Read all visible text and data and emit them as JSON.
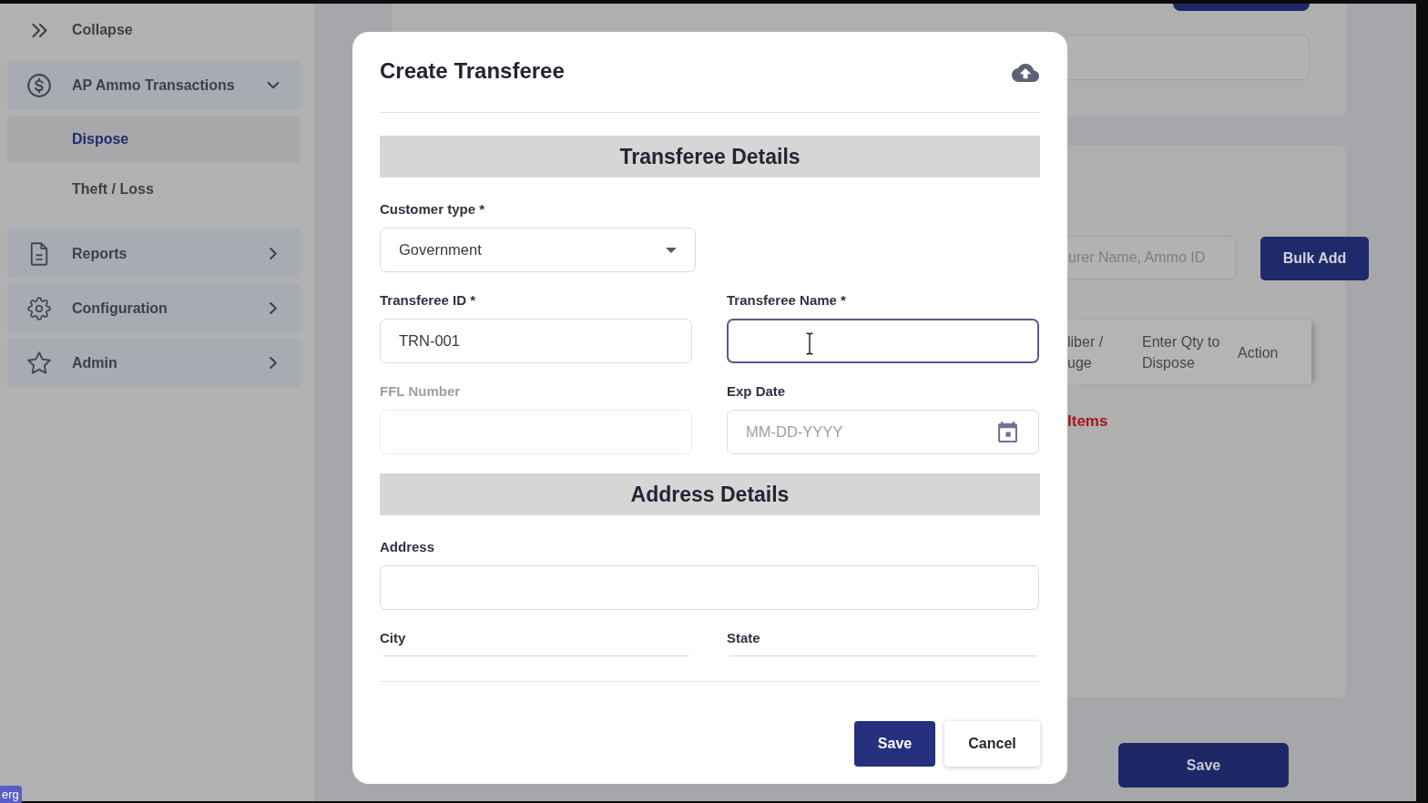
{
  "sidebar": {
    "collapse": {
      "label": "Collapse"
    },
    "items": [
      {
        "label": "AP Ammo Transactions",
        "expanded": true,
        "children": [
          {
            "label": "Dispose",
            "selected": true
          },
          {
            "label": "Theft / Loss",
            "selected": false
          }
        ]
      },
      {
        "label": "Reports",
        "expanded": false
      },
      {
        "label": "Configuration",
        "expanded": false
      },
      {
        "label": "Admin",
        "expanded": false
      }
    ]
  },
  "page": {
    "search": {
      "placeholder": "urer Name, Ammo ID"
    },
    "bulk_add_button": {
      "label": "Bulk Add"
    },
    "table": {
      "columns": [
        "liber / uge",
        "Enter Qty to Dispose",
        "Action"
      ]
    },
    "items_notice": "Items",
    "save_button": {
      "label": "Save"
    }
  },
  "dialog": {
    "title": "Create Transferee",
    "sections": [
      {
        "title": "Transferee Details",
        "rows": [
          {
            "fields": [
              {
                "kind": "select",
                "label": "Customer type *",
                "value": "Government",
                "focused": false,
                "disabled": false
              }
            ]
          },
          {
            "fields": [
              {
                "kind": "text",
                "label": "Transferee ID *",
                "value": "TRN-001",
                "focused": false,
                "disabled": false
              },
              {
                "kind": "text",
                "label": "Transferee Name *",
                "focused": true,
                "disabled": false
              }
            ]
          },
          {
            "fields": [
              {
                "kind": "text",
                "label": "FFL Number",
                "focused": false,
                "disabled": true
              },
              {
                "kind": "date",
                "label": "Exp Date",
                "placeholder": "MM-DD-YYYY",
                "focused": false,
                "disabled": false
              }
            ]
          }
        ]
      },
      {
        "title": "Address Details",
        "rows": [
          {
            "fields": [
              {
                "kind": "address",
                "label": "Address",
                "focused": false,
                "disabled": false
              }
            ]
          },
          {
            "fields": [
              {
                "kind": "line",
                "label": "City",
                "focused": false,
                "disabled": false
              },
              {
                "kind": "line",
                "label": "State",
                "focused": false,
                "disabled": false
              }
            ]
          }
        ]
      }
    ],
    "buttons": [
      {
        "label": "Save",
        "kind": "primary"
      },
      {
        "label": "Cancel",
        "kind": "secondary"
      }
    ]
  },
  "corner_badge": {
    "label": "erg"
  }
}
